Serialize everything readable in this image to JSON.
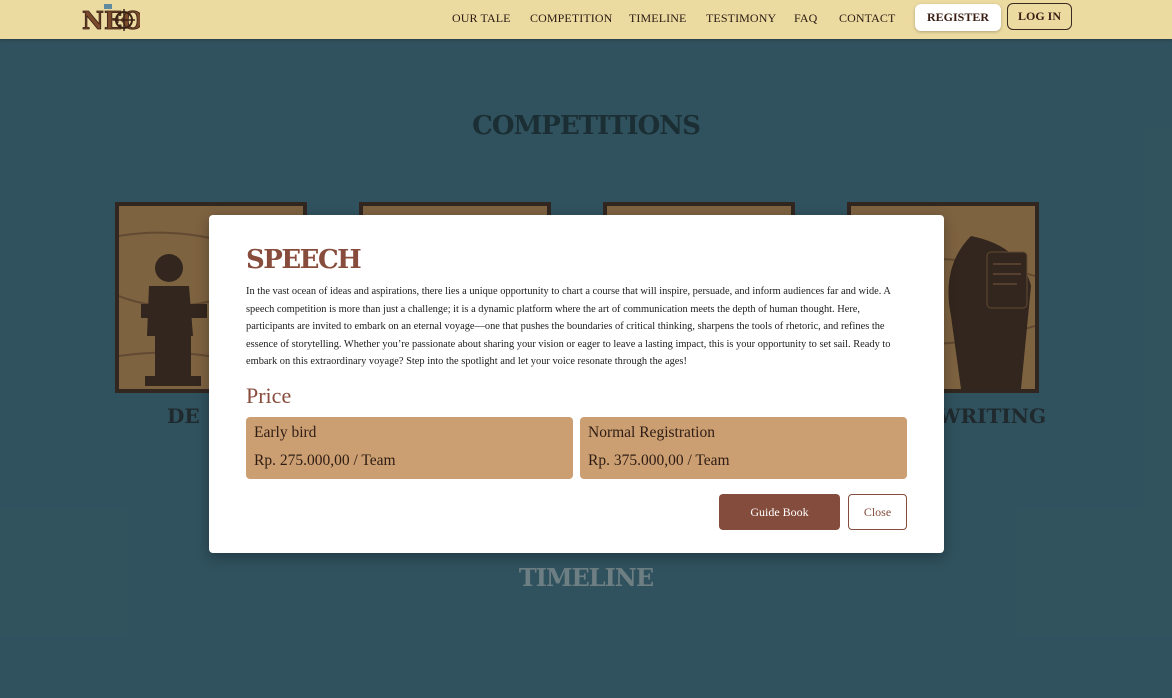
{
  "header": {
    "logo_text": "NEO",
    "nav": [
      "OUR TALE",
      "COMPETITION",
      "TIMELINE",
      "TESTIMONY",
      "FAQ",
      "CONTACT"
    ],
    "register_label": "REGISTER",
    "login_label": "LOG IN"
  },
  "competitions": {
    "title": "COMPETITIONS",
    "card_labels": [
      "DE",
      "WRITING"
    ]
  },
  "timeline": {
    "title": "TIMELINE"
  },
  "modal": {
    "title": "SPEECH",
    "description": "In the vast ocean of ideas and aspirations, there lies a unique opportunity to chart a course that will inspire, persuade, and inform audiences far and wide. A speech competition is more than just a challenge; it is a dynamic platform where the art of communication meets the depth of human thought. Here, participants are invited to embark on an eternal voyage—one that pushes the boundaries of critical thinking, sharpens the tools of rhetoric, and refines the essence of storytelling. Whether you’re passionate about sharing your vision or eager to leave a lasting impact, this is your opportunity to set sail. Ready to embark on this extraordinary voyage? Step into the spotlight and let your voice resonate through the ages!",
    "price_heading": "Price",
    "prices": [
      {
        "name": "Early bird",
        "value": "Rp. 275.000,00 / Team"
      },
      {
        "name": "Normal Registration",
        "value": "Rp. 375.000,00 / Team"
      }
    ],
    "guide_label": "Guide Book",
    "close_label": "Close"
  },
  "colors": {
    "background": "#38606d",
    "header": "#ecdba1",
    "accent": "#874c3c",
    "price_box": "#cc9f72"
  }
}
